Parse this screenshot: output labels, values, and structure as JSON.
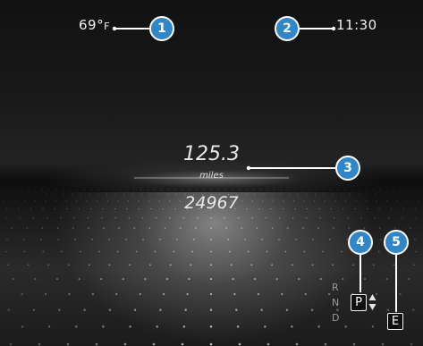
{
  "status_bar": {
    "outside_temperature": "69°",
    "temperature_unit": "F",
    "time": "11:30"
  },
  "trip": {
    "distance": "125.3",
    "unit": "miles"
  },
  "odometer": "24967",
  "transmission": {
    "gears": [
      "R",
      "N",
      "D"
    ],
    "selected_gear": "P"
  },
  "drive_program": "E",
  "callouts": [
    "1",
    "2",
    "3",
    "4",
    "5"
  ],
  "colors": {
    "callout_fill": "#2f86c8",
    "callout_ring": "#ffffff",
    "text": "#f2f2f2",
    "background": "#141414"
  }
}
